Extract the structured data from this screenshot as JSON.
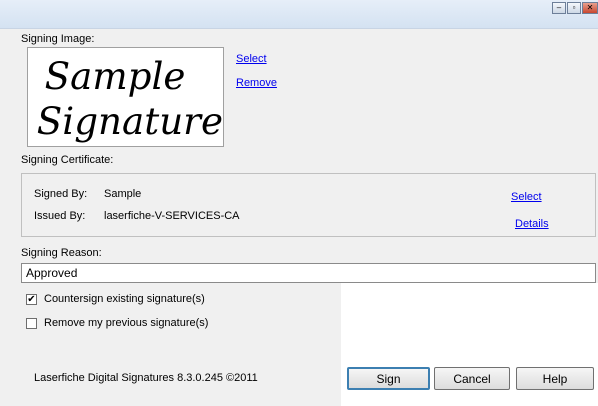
{
  "signing_image": {
    "label": "Signing Image:",
    "select_link": "Select",
    "remove_link": "Remove",
    "signature_text_line1": "Sample",
    "signature_text_line2": "Signature."
  },
  "signing_certificate": {
    "label": "Signing Certificate:",
    "signed_by_label": "Signed By:",
    "signed_by_value": "Sample",
    "issued_by_label": "Issued By:",
    "issued_by_value": "laserfiche-V-SERVICES-CA",
    "select_link": "Select",
    "details_link": "Details"
  },
  "signing_reason": {
    "label": "Signing Reason:",
    "value": "Approved"
  },
  "options": {
    "countersign_label": "Countersign existing signature(s)",
    "countersign_checked": true,
    "remove_previous_label": "Remove my previous signature(s)",
    "remove_previous_checked": false
  },
  "footer": {
    "version_text": "Laserfiche Digital Signatures 8.3.0.245 ©2011",
    "sign_button": "Sign",
    "cancel_button": "Cancel",
    "help_button": "Help"
  },
  "titlebar": {
    "minimize_glyph": "–",
    "maximize_glyph": "▫",
    "close_glyph": "✕"
  }
}
